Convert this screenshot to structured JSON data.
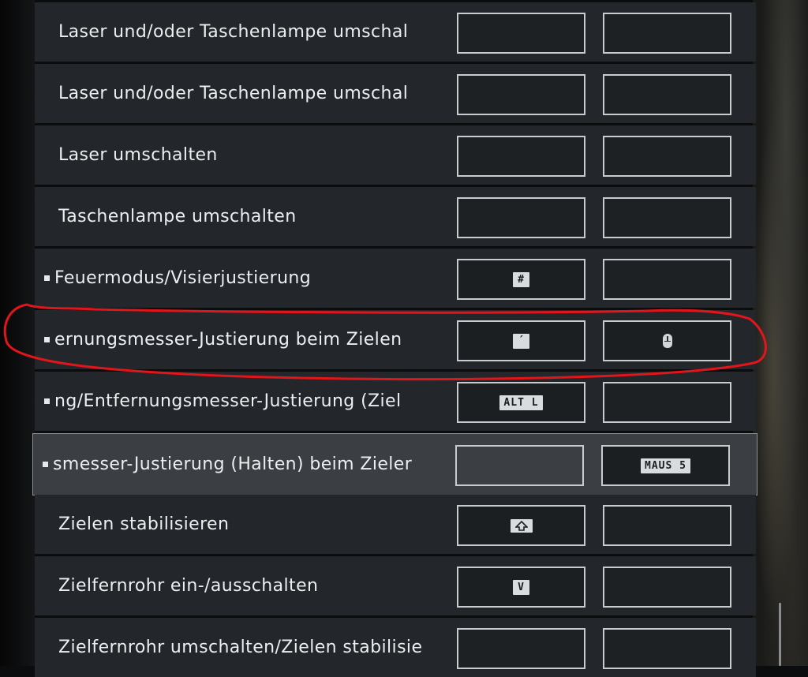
{
  "rows": [
    {
      "label": "Laser und/oder Taschenlampe umschal",
      "primary": "",
      "secondary": ""
    },
    {
      "label": "Laser und/oder Taschenlampe umschal",
      "primary": "",
      "secondary": ""
    },
    {
      "label": "Laser umschalten",
      "primary": "",
      "secondary": ""
    },
    {
      "label": "Taschenlampe umschalten",
      "primary": "",
      "secondary": ""
    },
    {
      "label": "Feuermodus/Visierjustierung",
      "primary": "#",
      "secondary": ""
    },
    {
      "label": "ernungsmesser-Justierung beim Zielen",
      "primary": "´",
      "secondary": "mouse-icon"
    },
    {
      "label": "ng/Entfernungsmesser-Justierung (Ziel",
      "primary": "ALT L",
      "secondary": ""
    },
    {
      "label": "smesser-Justierung (Halten) beim Zieler",
      "primary": "",
      "secondary": "MAUS 5"
    },
    {
      "label": "Zielen stabilisieren",
      "primary": "shift-icon",
      "secondary": ""
    },
    {
      "label": "Zielfernrohr ein-/ausschalten",
      "primary": "V",
      "secondary": ""
    },
    {
      "label": "Zielfernrohr umschalten/Zielen stabilisie",
      "primary": "",
      "secondary": ""
    }
  ],
  "colors": {
    "row_bg": "#23272b",
    "selected_bg": "#3b3f43",
    "annotation": "#e0161c"
  }
}
